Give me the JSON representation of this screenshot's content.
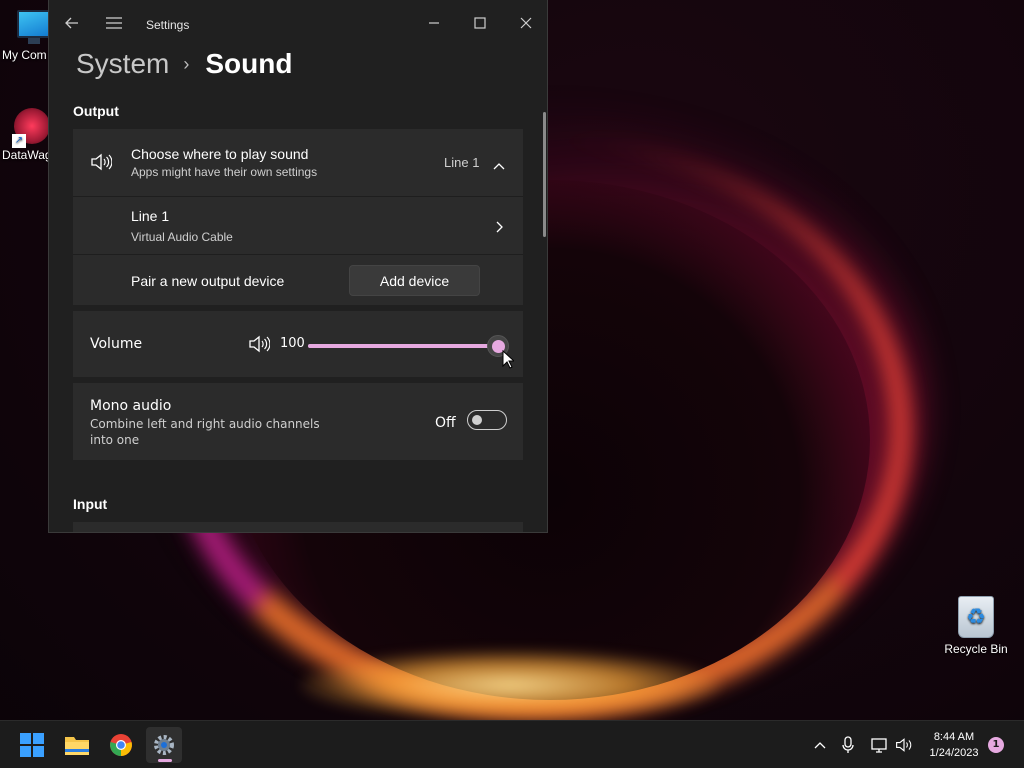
{
  "desktop": {
    "icons": [
      {
        "label": "My Com"
      },
      {
        "label": "DataWag"
      },
      {
        "label": "Recycle Bin"
      }
    ]
  },
  "window": {
    "title": "Settings",
    "breadcrumb": {
      "parent": "System",
      "separator": "›",
      "current": "Sound"
    },
    "output": {
      "heading": "Output",
      "choose": {
        "title": "Choose where to play sound",
        "subtitle": "Apps might have their own settings",
        "value": "Line 1"
      },
      "device": {
        "name": "Line 1",
        "detail": "Virtual Audio Cable"
      },
      "pair": {
        "label": "Pair a new output device",
        "button": "Add device"
      },
      "volume": {
        "label": "Volume",
        "value": "100",
        "level": 1.0
      },
      "mono": {
        "title": "Mono audio",
        "subtitle": "Combine left and right audio channels into one",
        "state": "Off"
      }
    },
    "input": {
      "heading": "Input"
    }
  },
  "taskbar": {
    "apps": [
      "start-icon",
      "file-explorer-icon",
      "chrome-icon",
      "settings-icon"
    ],
    "clock": {
      "time": "8:44 AM",
      "date": "1/24/2023"
    },
    "notification_count": "1"
  },
  "colors": {
    "accent": "#e6a9e0",
    "window_bg": "#202020",
    "card_bg": "#2b2b2b"
  }
}
